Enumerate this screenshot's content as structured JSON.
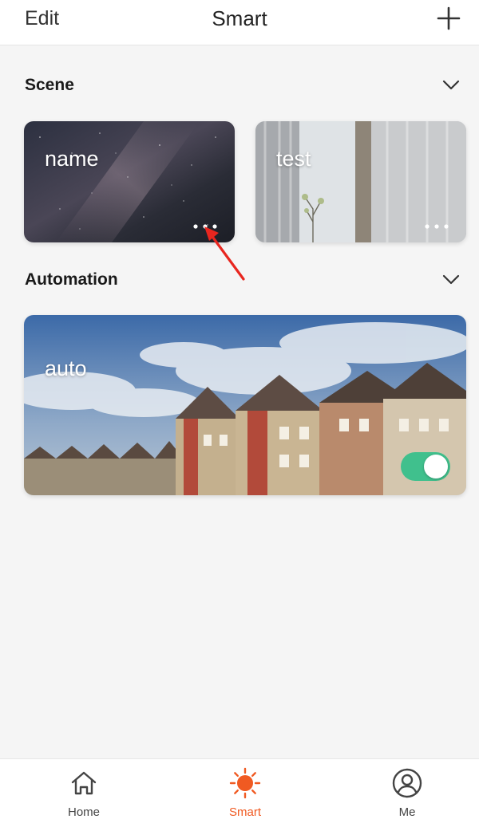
{
  "colors": {
    "accent": "#f05a22",
    "toggle_on": "#40c08d",
    "background": "#f5f5f5"
  },
  "header": {
    "edit_label": "Edit",
    "title": "Smart",
    "add_icon": "plus-icon"
  },
  "scene": {
    "title": "Scene",
    "cards": [
      {
        "label": "name"
      },
      {
        "label": "test"
      }
    ]
  },
  "automation": {
    "title": "Automation",
    "cards": [
      {
        "label": "auto",
        "enabled": true
      }
    ]
  },
  "tabbar": {
    "tabs": [
      {
        "label": "Home",
        "icon": "home-icon",
        "active": false
      },
      {
        "label": "Smart",
        "icon": "sun-icon",
        "active": true
      },
      {
        "label": "Me",
        "icon": "user-icon",
        "active": false
      }
    ]
  }
}
